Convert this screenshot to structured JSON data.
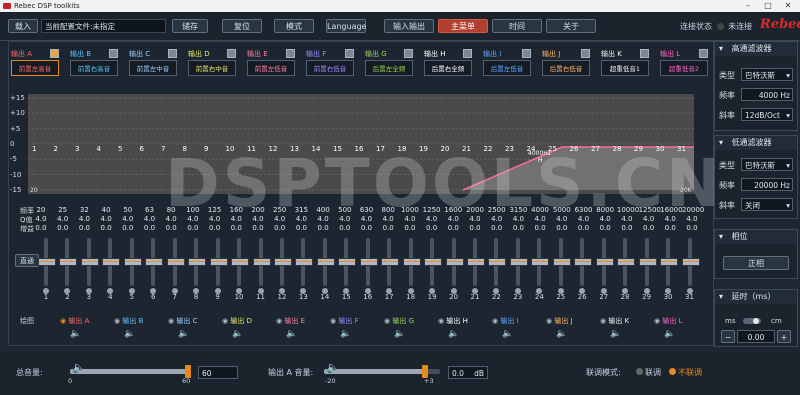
{
  "window": {
    "title": "Rebec DSP toolkits",
    "min": "–",
    "max": "□",
    "close": "✕"
  },
  "toolbar": {
    "load": "载入",
    "filename": "当前配置文件:未指定",
    "save": "储存",
    "reset": "复位",
    "mode": "模式",
    "language": "Language",
    "io": "输入输出",
    "main_menu": "主菜单",
    "time": "时间",
    "about": "关于",
    "status_label": "连接状态",
    "status_value": "未连接",
    "brand": "Rebec"
  },
  "outputs": [
    {
      "label": "输出 A",
      "name": "前置左高音",
      "color": "#ff6a6a",
      "checked": true
    },
    {
      "label": "输出 B",
      "name": "前置右高音",
      "color": "#5fc0ff",
      "checked": false
    },
    {
      "label": "输出 C",
      "name": "前置左中音",
      "color": "#9ccfff",
      "checked": false
    },
    {
      "label": "输出 D",
      "name": "前置右中音",
      "color": "#e5e571",
      "checked": false
    },
    {
      "label": "输出 E",
      "name": "前置左低音",
      "color": "#ff7d9d",
      "checked": false
    },
    {
      "label": "输出 F",
      "name": "前置右低音",
      "color": "#9a8bff",
      "checked": false
    },
    {
      "label": "输出 G",
      "name": "后置左全频",
      "color": "#9bd55b",
      "checked": false
    },
    {
      "label": "输出 H",
      "name": "后置右全频",
      "color": "#ffffff",
      "checked": false
    },
    {
      "label": "输出 I",
      "name": "后置左低音",
      "color": "#61a7ff",
      "checked": false
    },
    {
      "label": "输出 J",
      "name": "后置右低音",
      "color": "#ffb36a",
      "checked": false
    },
    {
      "label": "输出 K",
      "name": "超重低音1",
      "color": "#f5f5f5",
      "checked": false
    },
    {
      "label": "输出 L",
      "name": "超重低音2",
      "color": "#ff63c9",
      "checked": false
    }
  ],
  "eq": {
    "y_labels": [
      "+15",
      "+10",
      "+5",
      "0",
      "-5",
      "-10",
      "-15"
    ],
    "band_numbers": [
      "1",
      "2",
      "3",
      "4",
      "5",
      "6",
      "7",
      "8",
      "9",
      "10",
      "11",
      "12",
      "13",
      "14",
      "15",
      "16",
      "17",
      "18",
      "19",
      "20",
      "21",
      "22",
      "23",
      "24",
      "25",
      "26",
      "27",
      "28",
      "29",
      "30",
      "31"
    ],
    "freq_label": "频率",
    "q_label": "Q值",
    "gain_label": "增益",
    "freqs": [
      "20",
      "25",
      "32",
      "40",
      "50",
      "63",
      "80",
      "100",
      "125",
      "160",
      "200",
      "250",
      "315",
      "400",
      "500",
      "630",
      "800",
      "1000",
      "1250",
      "1600",
      "2000",
      "2500",
      "3150",
      "4000",
      "5000",
      "6300",
      "8000",
      "10000",
      "12500",
      "16000",
      "20000"
    ],
    "q": "4.0",
    "gain": "0.0",
    "marker": {
      "text": "4000Hz",
      "sub": "H"
    },
    "graph_x_start": "20",
    "graph_x_end": "20K",
    "pass_label": "直通",
    "draw_label": "绘图"
  },
  "draw_items": [
    {
      "label": "输出 A",
      "color": "#ff6a6a"
    },
    {
      "label": "输出 B",
      "color": "#5fc0ff"
    },
    {
      "label": "输出 C",
      "color": "#9ccfff"
    },
    {
      "label": "输出 D",
      "color": "#e5e571"
    },
    {
      "label": "输出 E",
      "color": "#ff7d9d"
    },
    {
      "label": "输出 F",
      "color": "#9a8bff"
    },
    {
      "label": "输出 G",
      "color": "#9bd55b"
    },
    {
      "label": "输出 H",
      "color": "#ffffff"
    },
    {
      "label": "输出 I",
      "color": "#61a7ff"
    },
    {
      "label": "输出 J",
      "color": "#ffb36a"
    },
    {
      "label": "输出 K",
      "color": "#f5f5f5"
    },
    {
      "label": "输出 L",
      "color": "#ff63c9"
    }
  ],
  "hp": {
    "title": "高通滤波器",
    "type_label": "类型",
    "type_value": "巴特沃斯",
    "freq_label": "频率",
    "freq_value": "4000",
    "freq_unit": "Hz",
    "slope_label": "斜率",
    "slope_value": "12dB/Oct"
  },
  "lp": {
    "title": "低通滤波器",
    "type_label": "类型",
    "type_value": "巴特沃斯",
    "freq_label": "频率",
    "freq_value": "20000",
    "freq_unit": "Hz",
    "slope_label": "斜率",
    "slope_value": "关闭"
  },
  "phase": {
    "title": "相位",
    "value": "正相"
  },
  "delay": {
    "title": "延时（ms）",
    "unit_ms": "ms",
    "unit_cm": "cm",
    "value": "0.00",
    "minus": "−",
    "plus": "+"
  },
  "bottom": {
    "total_label": "总音量:",
    "total_min": "0",
    "total_max": "60",
    "total_value": "60",
    "total_level": 1.0,
    "out_label": "输出 A 音量:",
    "out_min": "-20",
    "out_max": "+3",
    "out_value": "0.0",
    "out_unit": "dB",
    "out_level": 0.87,
    "link_label": "联调模式:",
    "link_on": "联调",
    "link_off": "不联调"
  },
  "watermark": "DSPTOOLS.CN"
}
